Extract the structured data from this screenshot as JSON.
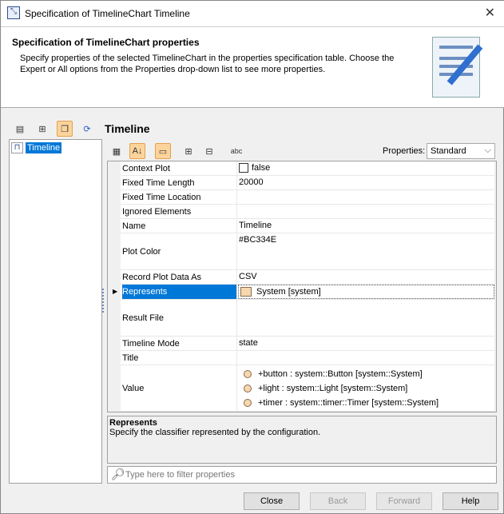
{
  "window": {
    "title": "Specification of TimelineChart Timeline"
  },
  "header": {
    "title": "Specification of TimelineChart properties",
    "description": "Specify properties of the selected TimelineChart in the properties specification table. Choose the Expert or All options from the Properties drop-down list to see more properties."
  },
  "tree": {
    "items": [
      {
        "label": "Timeline"
      }
    ]
  },
  "panel": {
    "title": "Timeline",
    "properties_label": "Properties:",
    "properties_value": "Standard"
  },
  "rows": [
    {
      "name": "Context Plot",
      "value": "false"
    },
    {
      "name": "Fixed Time Length",
      "value": "20000"
    },
    {
      "name": "Fixed Time Location",
      "value": ""
    },
    {
      "name": "Ignored Elements",
      "value": ""
    },
    {
      "name": "Name",
      "value": "Timeline"
    },
    {
      "name": "Plot Color",
      "value": "#BC334E"
    },
    {
      "name": "Record Plot Data As",
      "value": "CSV"
    },
    {
      "name": "Represents",
      "value": "System [system]"
    },
    {
      "name": "Result File",
      "value": ""
    },
    {
      "name": "Timeline Mode",
      "value": "state"
    },
    {
      "name": "Title",
      "value": ""
    },
    {
      "name": "Value",
      "values": [
        "+button : system::Button [system::System]",
        "+light : system::Light [system::System]",
        "+timer : system::timer::Timer [system::System]"
      ]
    }
  ],
  "description": {
    "title": "Represents",
    "text": "Specify the classifier represented by the configuration."
  },
  "filter": {
    "placeholder": "Type here to filter properties"
  },
  "buttons": {
    "close": "Close",
    "back": "Back",
    "forward": "Forward",
    "help": "Help"
  }
}
